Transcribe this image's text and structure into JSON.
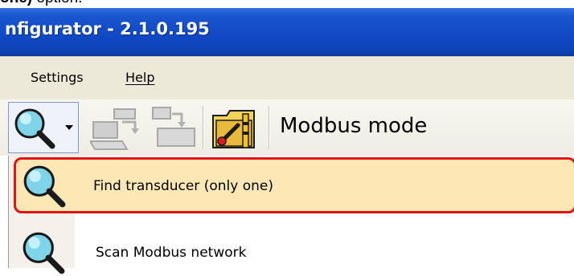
{
  "caption": {
    "bold_text": "one)",
    "rest_text": " option."
  },
  "window": {
    "title": "nfigurator - 2.1.0.195"
  },
  "menubar": {
    "items": [
      {
        "label": "Settings"
      },
      {
        "label": "Help"
      }
    ]
  },
  "toolbar": {
    "icons": [
      "search-icon",
      "chevron-down-icon",
      "send-computer-icon",
      "receive-computer-icon",
      "tools-folder-icon"
    ],
    "mode_label": "Modbus mode"
  },
  "dropdown": {
    "items": [
      {
        "label": "Find transducer (only one)",
        "icon": "search-icon",
        "highlighted": true
      },
      {
        "label": "Scan Modbus network",
        "icon": "search-icon",
        "highlighted": false
      }
    ]
  },
  "colors": {
    "titlebar": "#1149c6",
    "menubar": "#ece9d8",
    "highlight_fill": "#fde8b5",
    "highlight_border": "#e11313"
  }
}
